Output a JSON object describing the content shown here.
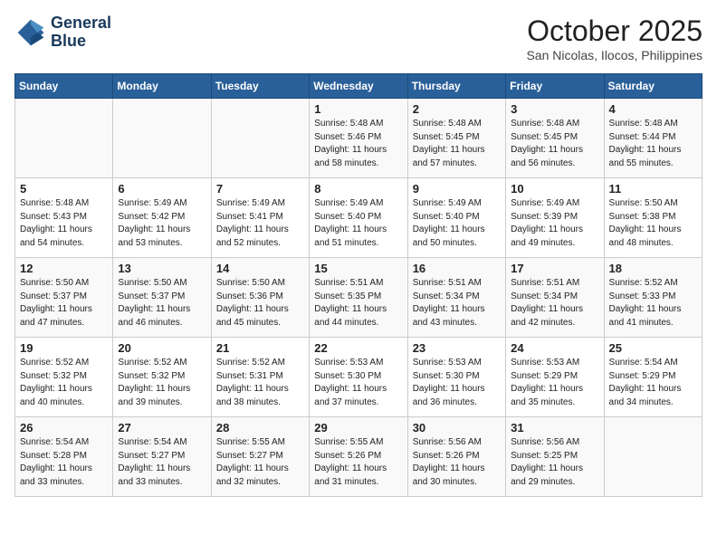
{
  "header": {
    "logo_line1": "General",
    "logo_line2": "Blue",
    "month": "October 2025",
    "location": "San Nicolas, Ilocos, Philippines"
  },
  "days_of_week": [
    "Sunday",
    "Monday",
    "Tuesday",
    "Wednesday",
    "Thursday",
    "Friday",
    "Saturday"
  ],
  "weeks": [
    [
      {
        "num": "",
        "info": ""
      },
      {
        "num": "",
        "info": ""
      },
      {
        "num": "",
        "info": ""
      },
      {
        "num": "1",
        "info": "Sunrise: 5:48 AM\nSunset: 5:46 PM\nDaylight: 11 hours\nand 58 minutes."
      },
      {
        "num": "2",
        "info": "Sunrise: 5:48 AM\nSunset: 5:45 PM\nDaylight: 11 hours\nand 57 minutes."
      },
      {
        "num": "3",
        "info": "Sunrise: 5:48 AM\nSunset: 5:45 PM\nDaylight: 11 hours\nand 56 minutes."
      },
      {
        "num": "4",
        "info": "Sunrise: 5:48 AM\nSunset: 5:44 PM\nDaylight: 11 hours\nand 55 minutes."
      }
    ],
    [
      {
        "num": "5",
        "info": "Sunrise: 5:48 AM\nSunset: 5:43 PM\nDaylight: 11 hours\nand 54 minutes."
      },
      {
        "num": "6",
        "info": "Sunrise: 5:49 AM\nSunset: 5:42 PM\nDaylight: 11 hours\nand 53 minutes."
      },
      {
        "num": "7",
        "info": "Sunrise: 5:49 AM\nSunset: 5:41 PM\nDaylight: 11 hours\nand 52 minutes."
      },
      {
        "num": "8",
        "info": "Sunrise: 5:49 AM\nSunset: 5:40 PM\nDaylight: 11 hours\nand 51 minutes."
      },
      {
        "num": "9",
        "info": "Sunrise: 5:49 AM\nSunset: 5:40 PM\nDaylight: 11 hours\nand 50 minutes."
      },
      {
        "num": "10",
        "info": "Sunrise: 5:49 AM\nSunset: 5:39 PM\nDaylight: 11 hours\nand 49 minutes."
      },
      {
        "num": "11",
        "info": "Sunrise: 5:50 AM\nSunset: 5:38 PM\nDaylight: 11 hours\nand 48 minutes."
      }
    ],
    [
      {
        "num": "12",
        "info": "Sunrise: 5:50 AM\nSunset: 5:37 PM\nDaylight: 11 hours\nand 47 minutes."
      },
      {
        "num": "13",
        "info": "Sunrise: 5:50 AM\nSunset: 5:37 PM\nDaylight: 11 hours\nand 46 minutes."
      },
      {
        "num": "14",
        "info": "Sunrise: 5:50 AM\nSunset: 5:36 PM\nDaylight: 11 hours\nand 45 minutes."
      },
      {
        "num": "15",
        "info": "Sunrise: 5:51 AM\nSunset: 5:35 PM\nDaylight: 11 hours\nand 44 minutes."
      },
      {
        "num": "16",
        "info": "Sunrise: 5:51 AM\nSunset: 5:34 PM\nDaylight: 11 hours\nand 43 minutes."
      },
      {
        "num": "17",
        "info": "Sunrise: 5:51 AM\nSunset: 5:34 PM\nDaylight: 11 hours\nand 42 minutes."
      },
      {
        "num": "18",
        "info": "Sunrise: 5:52 AM\nSunset: 5:33 PM\nDaylight: 11 hours\nand 41 minutes."
      }
    ],
    [
      {
        "num": "19",
        "info": "Sunrise: 5:52 AM\nSunset: 5:32 PM\nDaylight: 11 hours\nand 40 minutes."
      },
      {
        "num": "20",
        "info": "Sunrise: 5:52 AM\nSunset: 5:32 PM\nDaylight: 11 hours\nand 39 minutes."
      },
      {
        "num": "21",
        "info": "Sunrise: 5:52 AM\nSunset: 5:31 PM\nDaylight: 11 hours\nand 38 minutes."
      },
      {
        "num": "22",
        "info": "Sunrise: 5:53 AM\nSunset: 5:30 PM\nDaylight: 11 hours\nand 37 minutes."
      },
      {
        "num": "23",
        "info": "Sunrise: 5:53 AM\nSunset: 5:30 PM\nDaylight: 11 hours\nand 36 minutes."
      },
      {
        "num": "24",
        "info": "Sunrise: 5:53 AM\nSunset: 5:29 PM\nDaylight: 11 hours\nand 35 minutes."
      },
      {
        "num": "25",
        "info": "Sunrise: 5:54 AM\nSunset: 5:29 PM\nDaylight: 11 hours\nand 34 minutes."
      }
    ],
    [
      {
        "num": "26",
        "info": "Sunrise: 5:54 AM\nSunset: 5:28 PM\nDaylight: 11 hours\nand 33 minutes."
      },
      {
        "num": "27",
        "info": "Sunrise: 5:54 AM\nSunset: 5:27 PM\nDaylight: 11 hours\nand 33 minutes."
      },
      {
        "num": "28",
        "info": "Sunrise: 5:55 AM\nSunset: 5:27 PM\nDaylight: 11 hours\nand 32 minutes."
      },
      {
        "num": "29",
        "info": "Sunrise: 5:55 AM\nSunset: 5:26 PM\nDaylight: 11 hours\nand 31 minutes."
      },
      {
        "num": "30",
        "info": "Sunrise: 5:56 AM\nSunset: 5:26 PM\nDaylight: 11 hours\nand 30 minutes."
      },
      {
        "num": "31",
        "info": "Sunrise: 5:56 AM\nSunset: 5:25 PM\nDaylight: 11 hours\nand 29 minutes."
      },
      {
        "num": "",
        "info": ""
      }
    ]
  ]
}
